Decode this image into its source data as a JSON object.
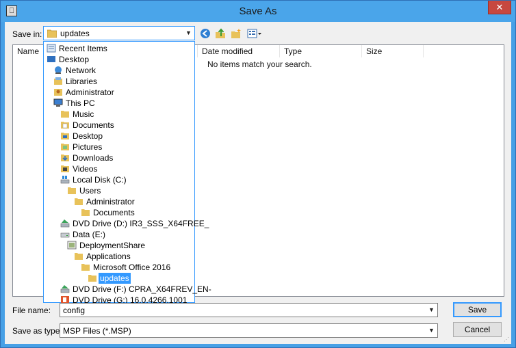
{
  "window": {
    "title": "Save As"
  },
  "toolbar": {
    "save_in_label": "Save in:",
    "save_in_value": "updates"
  },
  "columns": {
    "name": "Name",
    "date_modified": "Date modified",
    "type": "Type",
    "size": "Size"
  },
  "list": {
    "empty_message": "No items match your search."
  },
  "dropdown": {
    "items": [
      {
        "label": "Recent Items",
        "icon": "recent-items-icon"
      },
      {
        "label": "Desktop",
        "icon": "desktop-icon"
      },
      {
        "label": "Network",
        "icon": "network-icon"
      },
      {
        "label": "Libraries",
        "icon": "libraries-icon"
      },
      {
        "label": "Administrator",
        "icon": "user-folder-icon"
      },
      {
        "label": "This PC",
        "icon": "computer-icon"
      },
      {
        "label": "Music",
        "icon": "music-folder-icon"
      },
      {
        "label": "Documents",
        "icon": "documents-folder-icon"
      },
      {
        "label": "Desktop",
        "icon": "desktop-folder-icon"
      },
      {
        "label": "Pictures",
        "icon": "pictures-folder-icon"
      },
      {
        "label": "Downloads",
        "icon": "downloads-folder-icon"
      },
      {
        "label": "Videos",
        "icon": "videos-folder-icon"
      },
      {
        "label": "Local Disk (C:)",
        "icon": "local-disk-icon"
      },
      {
        "label": "Users",
        "icon": "folder-icon"
      },
      {
        "label": "Administrator",
        "icon": "folder-icon"
      },
      {
        "label": "Documents",
        "icon": "folder-icon"
      },
      {
        "label": "DVD Drive (D:) IR3_SSS_X64FREE_",
        "icon": "dvd-drive-icon"
      },
      {
        "label": "Data (E:)",
        "icon": "drive-icon"
      },
      {
        "label": "DeploymentShare",
        "icon": "deployment-share-icon"
      },
      {
        "label": "Applications",
        "icon": "folder-icon"
      },
      {
        "label": "Microsoft Office 2016",
        "icon": "folder-icon"
      },
      {
        "label": "updates",
        "icon": "folder-icon"
      },
      {
        "label": "DVD Drive (F:) CPRA_X64FREV_EN-",
        "icon": "dvd-drive-icon"
      },
      {
        "label": "DVD Drive (G:) 16.0.4266.1001",
        "icon": "office-dvd-icon"
      }
    ]
  },
  "file_name": {
    "label": "File name:",
    "value": "config"
  },
  "save_as_type": {
    "label": "Save as type:",
    "value": "MSP Files (*.MSP)"
  },
  "buttons": {
    "save": "Save",
    "cancel": "Cancel"
  },
  "colors": {
    "title_bar": "#4aa5ea",
    "accent": "#3399ff",
    "close": "#c7483f"
  }
}
